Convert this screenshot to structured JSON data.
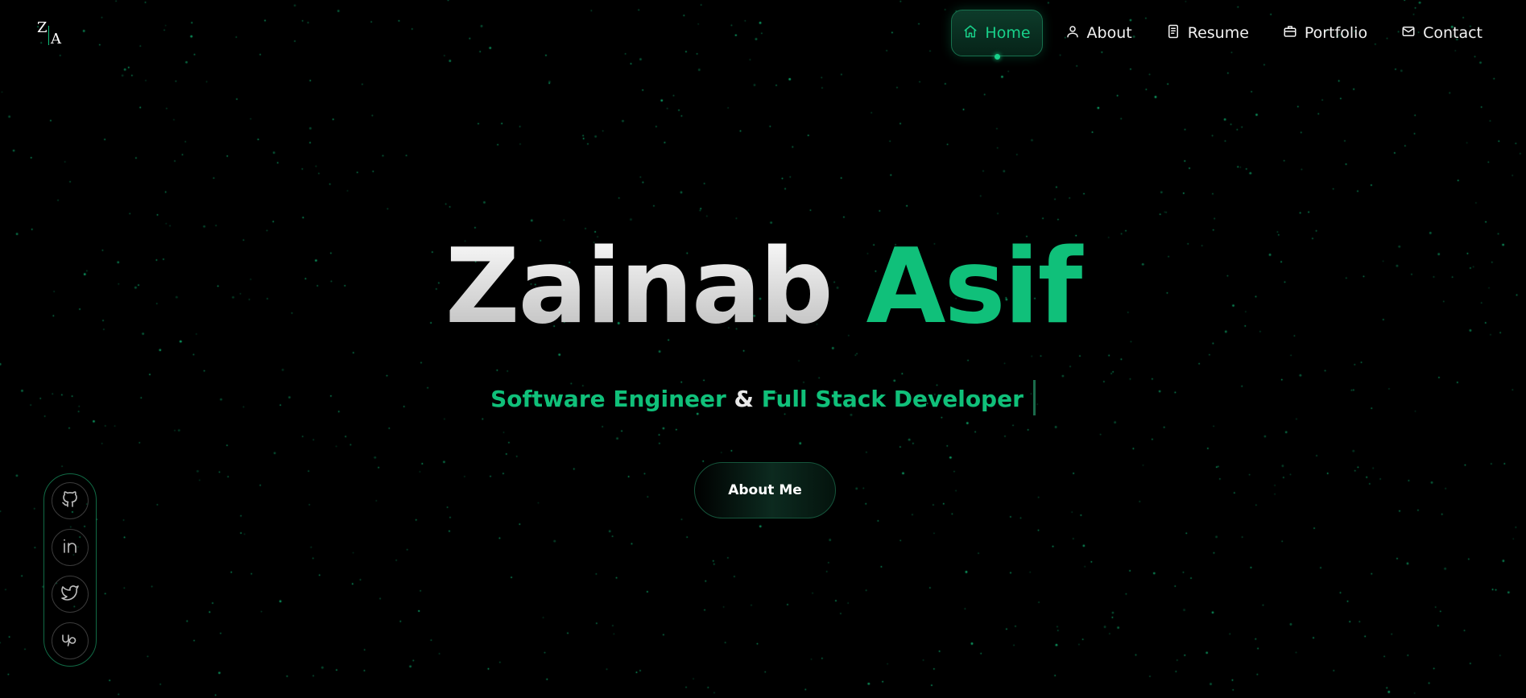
{
  "brand": {
    "logo_top": "Z",
    "logo_bottom": "A"
  },
  "nav": {
    "items": [
      {
        "label": "Home",
        "icon": "home-icon",
        "active": true
      },
      {
        "label": "About",
        "icon": "user-icon",
        "active": false
      },
      {
        "label": "Resume",
        "icon": "document-icon",
        "active": false
      },
      {
        "label": "Portfolio",
        "icon": "briefcase-icon",
        "active": false
      },
      {
        "label": "Contact",
        "icon": "mail-icon",
        "active": false
      }
    ]
  },
  "hero": {
    "first_name": "Zainab",
    "last_name": "Asif",
    "role_1": "Software Engineer",
    "connector": "&",
    "role_2": "Full Stack Developer",
    "cta_label": "About Me"
  },
  "social": [
    {
      "icon": "github-icon"
    },
    {
      "icon": "linkedin-icon"
    },
    {
      "icon": "twitter-icon"
    },
    {
      "icon": "upwork-icon"
    }
  ],
  "colors": {
    "background": "#000000",
    "accent": "#10c07a",
    "accent_bright": "#18d18a",
    "text": "#f2f2f2"
  }
}
